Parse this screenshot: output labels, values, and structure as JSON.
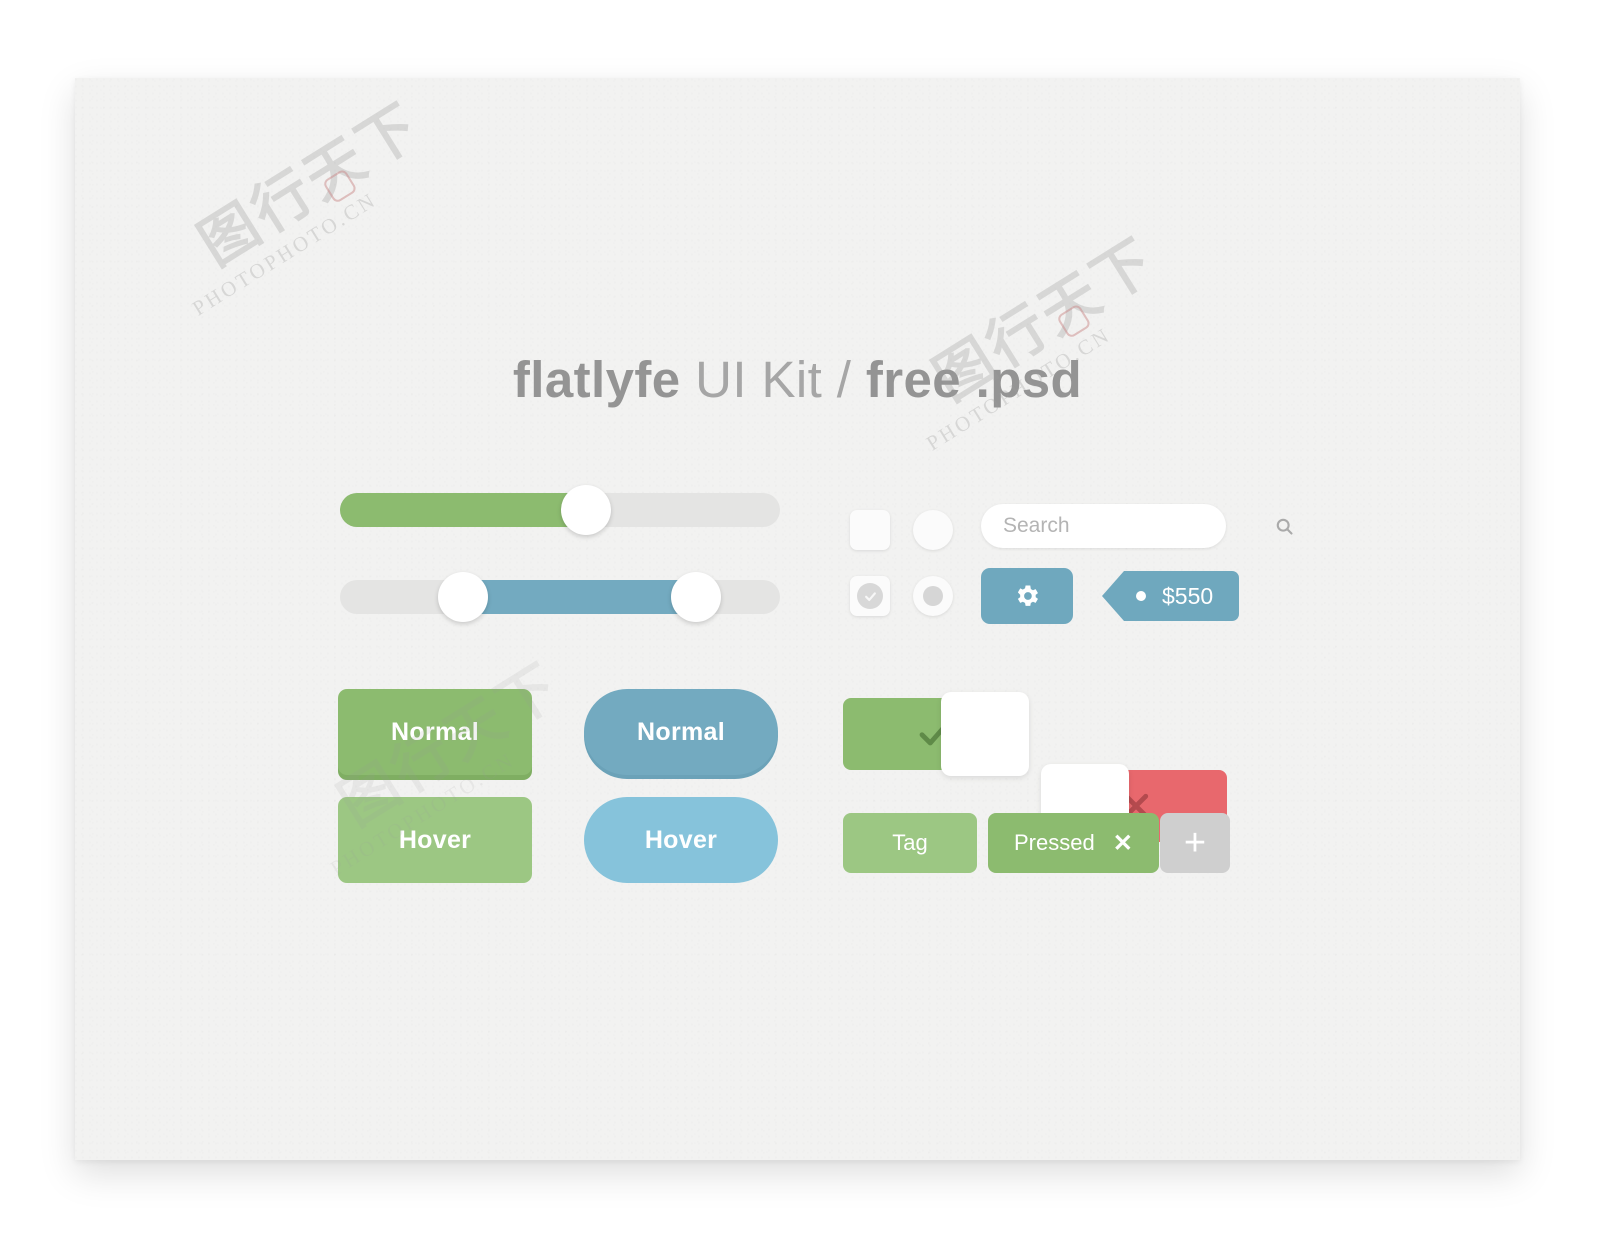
{
  "page": {
    "title_bold_1": "flatlyfe",
    "title_regular": " UI Kit / ",
    "title_bold_2": "free .psd",
    "background_color": "#ffffff",
    "card_color": "#f2f2f1"
  },
  "colors": {
    "green": "#8CBB6F",
    "green_light": "#9CC783",
    "green_shadow": "#7fae62",
    "blue": "#73AAC0",
    "blue_light": "#86C3DB",
    "red": "#E8686D",
    "track_gray": "#e4e4e3",
    "tag_add_gray": "#cfcfcf",
    "text_gray": "#9a9a9a"
  },
  "sliders": [
    {
      "name": "green-slider",
      "fill_color": "#8CBB6F",
      "value_percent": 56,
      "handles": [
        56
      ]
    },
    {
      "name": "blue-range-slider",
      "fill_color": "#73AAC0",
      "range_start_percent": 28,
      "range_end_percent": 81,
      "handles": [
        28,
        81
      ]
    }
  ],
  "controls": {
    "checkbox_unchecked": {
      "label": "",
      "checked": false
    },
    "checkbox_checked": {
      "label": "",
      "checked": true
    },
    "radio_unchecked": {
      "label": "",
      "selected": false
    },
    "radio_checked": {
      "label": "",
      "selected": true
    }
  },
  "search": {
    "placeholder": "Search",
    "value": "",
    "icon": "search-icon"
  },
  "gear_button": {
    "icon": "gear-icon",
    "color": "#6fa8be"
  },
  "price_tag": {
    "label": "$550",
    "color": "#6fa8be"
  },
  "buttons": [
    {
      "label": "Normal",
      "style": "green-rect",
      "state": "normal"
    },
    {
      "label": "Hover",
      "style": "green-rect",
      "state": "hover"
    },
    {
      "label": "Normal",
      "style": "blue-pill",
      "state": "normal"
    },
    {
      "label": "Hover",
      "style": "blue-pill",
      "state": "hover"
    }
  ],
  "toggles": [
    {
      "name": "toggle-on",
      "icon": "check-icon",
      "state": "on",
      "color": "#8CBB6F",
      "knob_side": "right"
    },
    {
      "name": "toggle-off",
      "icon": "cross-icon",
      "state": "off",
      "color": "#E8686D",
      "knob_side": "left"
    }
  ],
  "tags": [
    {
      "label": "Tag",
      "state": "normal",
      "has_close": false
    },
    {
      "label": "Pressed",
      "state": "pressed",
      "has_close": true,
      "close_glyph": "✕"
    },
    {
      "label": "+",
      "state": "add",
      "has_close": false
    }
  ],
  "watermark": {
    "site": "PHOTOPHOTO.CN",
    "cjk": "图行天下"
  }
}
